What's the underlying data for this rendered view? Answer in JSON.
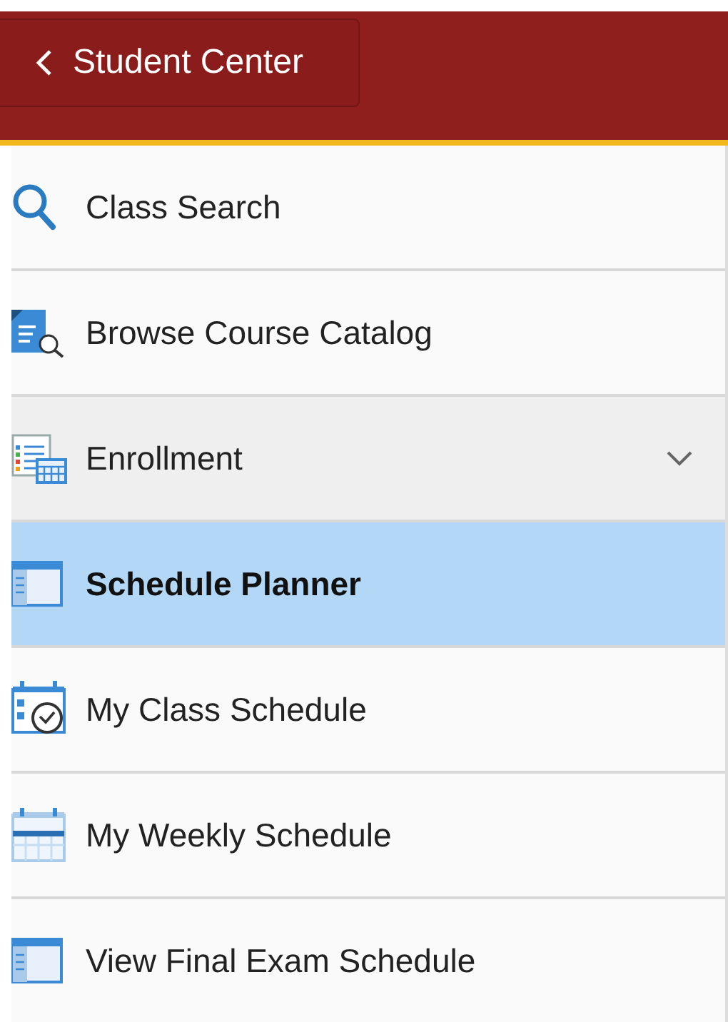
{
  "header": {
    "back_button": {
      "label": "Student Center"
    }
  },
  "menu": [
    {
      "label": "Class Search",
      "kind": "link",
      "selected": false
    },
    {
      "label": "Browse Course Catalog",
      "kind": "link",
      "selected": false
    },
    {
      "label": "Enrollment",
      "kind": "group",
      "expanded": false,
      "selected": false
    },
    {
      "label": "Schedule Planner",
      "kind": "link",
      "selected": true
    },
    {
      "label": "My Class Schedule",
      "kind": "link",
      "selected": false
    },
    {
      "label": "My Weekly Schedule",
      "kind": "link",
      "selected": false
    },
    {
      "label": "View Final Exam Schedule",
      "kind": "link",
      "selected": false
    }
  ]
}
